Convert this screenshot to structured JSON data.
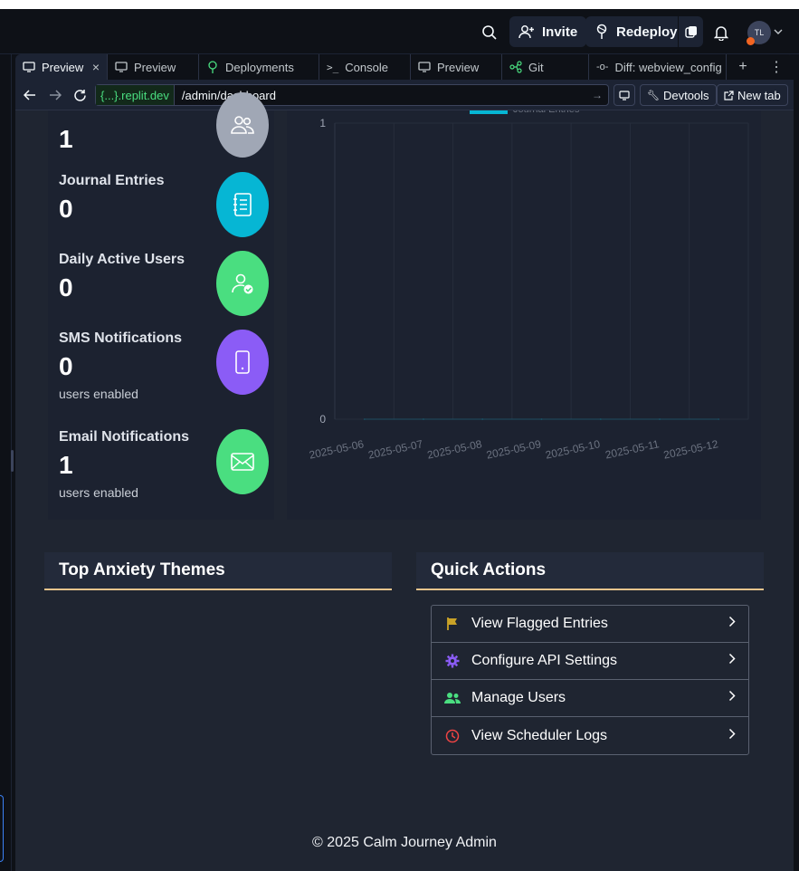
{
  "topbar": {
    "invite_label": "Invite",
    "redeploy_label": "Redeploy",
    "avatar_initials": "TL"
  },
  "tabs": [
    {
      "label": "Preview",
      "icon": "monitor-icon"
    },
    {
      "label": "Preview",
      "icon": "monitor-icon"
    },
    {
      "label": "Deployments",
      "icon": "deploy-icon"
    },
    {
      "label": "Console",
      "icon": "terminal-icon"
    },
    {
      "label": "Preview",
      "icon": "monitor-icon"
    },
    {
      "label": "Git",
      "icon": "git-icon"
    },
    {
      "label": "Diff: webview_config",
      "icon": "diff-icon"
    }
  ],
  "urlbar": {
    "domain": "{...}.replit.dev",
    "path": "/admin/dashboard",
    "devtools_label": "Devtools",
    "newtab_label": "New tab"
  },
  "stats": {
    "users_value": "1",
    "journal_label": "Journal Entries",
    "journal_value": "0",
    "dau_label": "Daily Active Users",
    "dau_value": "0",
    "sms_label": "SMS Notifications",
    "sms_value": "0",
    "sms_sub": "users enabled",
    "email_label": "Email Notifications",
    "email_value": "1",
    "email_sub": "users enabled"
  },
  "chart_data": {
    "type": "line",
    "x": [
      "2025-05-06",
      "2025-05-07",
      "2025-05-08",
      "2025-05-09",
      "2025-05-10",
      "2025-05-11",
      "2025-05-12"
    ],
    "series": [
      {
        "name": "Journal Entries",
        "values": [
          0,
          0,
          0,
          0,
          0,
          0,
          0
        ],
        "color": "#06b6d4"
      }
    ],
    "yticks": [
      "0",
      "1"
    ],
    "ylim": [
      0,
      1
    ],
    "grid": true,
    "legend": "top"
  },
  "sections": {
    "themes_title": "Top Anxiety Themes",
    "actions_title": "Quick Actions"
  },
  "quick_actions": [
    {
      "label": "View Flagged Entries",
      "icon": "flag-icon",
      "color": "#c9a227"
    },
    {
      "label": "Configure API Settings",
      "icon": "gear-icon",
      "color": "#8b5cf6"
    },
    {
      "label": "Manage Users",
      "icon": "users-icon",
      "color": "#4ade80"
    },
    {
      "label": "View Scheduler Logs",
      "icon": "clock-icon",
      "color": "#ef4444"
    }
  ],
  "footer": "© 2025 Calm Journey Admin",
  "colors": {
    "users_icon_bg": "#a0a7b5",
    "journal_icon_bg": "#06b6d4",
    "dau_icon_bg": "#4ade80",
    "sms_icon_bg": "#8b5cf6",
    "email_icon_bg": "#4ade80",
    "section_underline": "#e7c48c"
  }
}
